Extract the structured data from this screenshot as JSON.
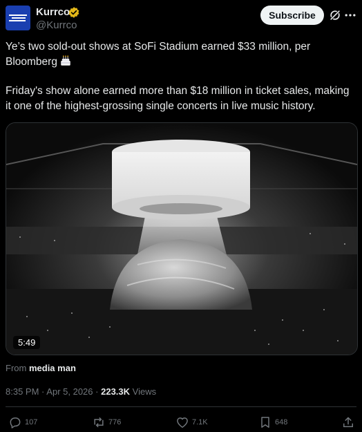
{
  "author": {
    "name": "Kurrco",
    "handle": "@Kurrco",
    "verified": true,
    "subscribe_label": "Subscribe"
  },
  "tweet": {
    "paragraph1": "Ye’s two sold-out shows at SoFi Stadium earned $33 million, per Bloomberg",
    "paragraph1_emoji": "birthday-cake-emoji",
    "paragraph2": "Friday's show alone earned more than $18 million in ticket sales, making it one of the highest-grossing single concerts in live music history."
  },
  "media": {
    "duration": "5:49",
    "description_icon": "concert-video-thumbnail"
  },
  "source": {
    "prefix": "From",
    "name": "media man"
  },
  "meta": {
    "time": "8:35 PM",
    "separator": "·",
    "date": "Apr 5, 2026",
    "views_count": "223.3K",
    "views_label": "Views"
  },
  "actions": {
    "replies": "107",
    "reposts": "776",
    "likes": "7.1K",
    "bookmarks": "648"
  },
  "colors": {
    "background": "#000000",
    "text_primary": "#e7e9ea",
    "text_secondary": "#71767b",
    "verified_gold": "#e2b719",
    "avatar_blue": "#1a3fb0"
  }
}
